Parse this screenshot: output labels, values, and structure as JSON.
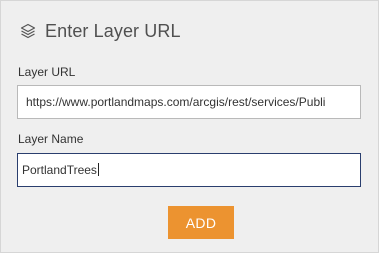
{
  "header": {
    "icon": "layers-icon",
    "title": "Enter Layer URL"
  },
  "fields": {
    "url_label": "Layer URL",
    "url_value": "https://www.portlandmaps.com/arcgis/rest/services/Publi",
    "name_label": "Layer Name",
    "name_value": "PortlandTrees"
  },
  "actions": {
    "add_label": "ADD"
  },
  "colors": {
    "accent": "#ec9330",
    "focus_border": "#2a3e6e",
    "panel_bg": "#efefef"
  }
}
